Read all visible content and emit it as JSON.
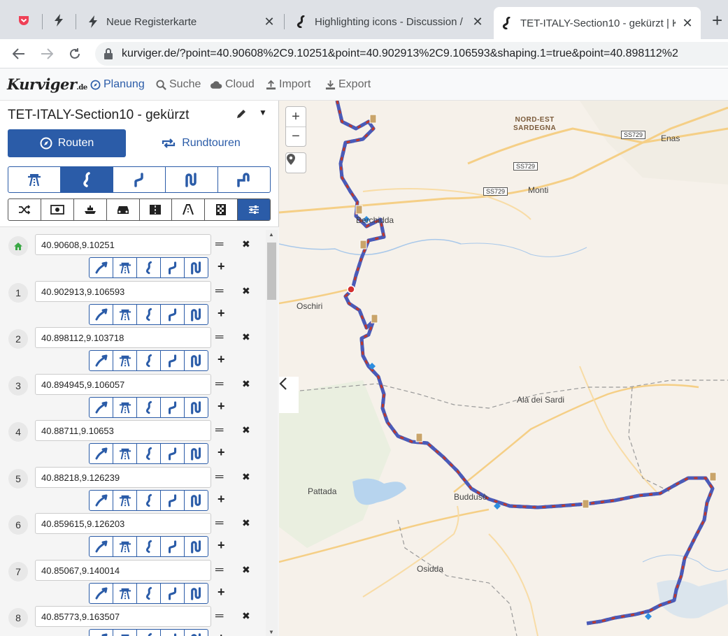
{
  "browser": {
    "tabs": [
      {
        "title": "Neue Registerkarte",
        "active": false
      },
      {
        "title": "Highlighting icons - Discussion /",
        "active": false
      },
      {
        "title": "TET-ITALY-Section10 - gekürzt | K",
        "active": true
      }
    ],
    "url": "kurviger.de/?point=40.90608%2C9.10251&point=40.902913%2C9.106593&shaping.1=true&point=40.898112%2"
  },
  "app": {
    "logo_main": "Kurviger",
    "logo_suffix": ".de",
    "menu": [
      {
        "label": "Planung",
        "active": true
      },
      {
        "label": "Suche",
        "active": false
      },
      {
        "label": "Cloud",
        "active": false
      },
      {
        "label": "Import",
        "active": false
      },
      {
        "label": "Export",
        "active": false
      }
    ]
  },
  "sidebar": {
    "route_title": "TET-ITALY-Section10 - gekürzt",
    "mode_routen": "Routen",
    "mode_rundtouren": "Rundtouren",
    "waypoints": [
      {
        "marker": "home",
        "value": "40.90608,9.10251"
      },
      {
        "marker": "1",
        "value": "40.902913,9.106593"
      },
      {
        "marker": "2",
        "value": "40.898112,9.103718"
      },
      {
        "marker": "3",
        "value": "40.894945,9.106057"
      },
      {
        "marker": "4",
        "value": "40.88711,9.10653"
      },
      {
        "marker": "5",
        "value": "40.88218,9.126239"
      },
      {
        "marker": "6",
        "value": "40.859615,9.126203"
      },
      {
        "marker": "7",
        "value": "40.85067,9.140014"
      },
      {
        "marker": "8",
        "value": "40.85773,9.163507"
      }
    ]
  },
  "map": {
    "places": [
      {
        "name": "Enas"
      },
      {
        "name": "Monti"
      },
      {
        "name": "Berchidda"
      },
      {
        "name": "Oschiri"
      },
      {
        "name": "Alà dei Sardi"
      },
      {
        "name": "Pattada"
      },
      {
        "name": "Buddusò"
      },
      {
        "name": "Osidda"
      }
    ],
    "region_label_1": "NORD-EST",
    "region_label_2": "SARDEGNA",
    "road_shields": [
      "SS729",
      "SS729",
      "SS729"
    ],
    "zoom_in": "+",
    "zoom_out": "−"
  },
  "colors": {
    "accent": "#2b5ca8",
    "route_blue": "#4a5bb8",
    "route_red": "#c0392b"
  }
}
